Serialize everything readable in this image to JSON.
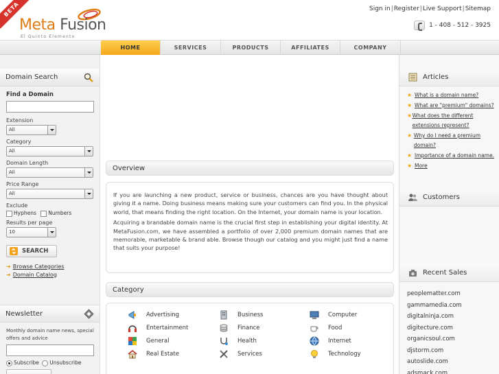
{
  "header": {
    "beta": "BETA",
    "logo_meta": "Meta",
    "logo_fusion": "Fusion",
    "tagline": "El Quinto Elemento",
    "links": [
      "Sign in",
      "Register",
      "Live Support",
      "Sitemap"
    ],
    "phone": "1 - 408 - 512 - 3925"
  },
  "nav": [
    "HOME",
    "SERVICES",
    "PRODUCTS",
    "AFFILIATES",
    "COMPANY"
  ],
  "domain_search": {
    "title": "Domain Search",
    "find_label": "Find a Domain",
    "find_value": "",
    "extension_label": "Extension",
    "extension_value": "All",
    "category_label": "Category",
    "category_value": "All",
    "length_label": "Domain Length",
    "length_value": "All",
    "price_label": "Price Range",
    "price_value": "All",
    "exclude_label": "Exclude",
    "hyphens": "Hyphens",
    "numbers": "Numbers",
    "results_label": "Results per page",
    "results_value": "10",
    "search_button": "SEARCH",
    "browse_link": "Browse Categories",
    "catalog_link": "Domain Catalog"
  },
  "newsletter": {
    "title": "Newsletter",
    "desc": "Monthly domain name news, special offers and advice",
    "email_value": "",
    "subscribe": "Subscribe",
    "unsubscribe": "Unsubscribe"
  },
  "overview": {
    "title": "Overview",
    "p1": "If you are launching a new product, service or business, chances are you have thought about giving it a name. Doing business means making sure your customers can find you. In the physical world, that means finding the right location. On the Internet, your domain name is your location.",
    "p2": "Acquiring a brandable domain name is the crucial first step in establishing your digital identity. At MetaFusion.com, we have assembled a portfolio of over 2,000 premium domain names that are memorable, marketable & brand able. Browse though our catalog and you might just find a name that suits your purpose!"
  },
  "category": {
    "title": "Category",
    "items": [
      "Advertising",
      "Business",
      "Computer",
      "Entertainment",
      "Finance",
      "Food",
      "General",
      "Health",
      "Internet",
      "Real Estate",
      "Services",
      "Technology"
    ]
  },
  "articles": {
    "title": "Articles",
    "items": [
      "What is a domain name?",
      "What are \"premium\" domains?",
      "What does the different extensions represent?",
      "Why do I need a premium domain?",
      "Importance of a domain name.",
      "More"
    ]
  },
  "customers": {
    "title": "Customers"
  },
  "recent_sales": {
    "title": "Recent Sales",
    "items": [
      "peoplematter.com",
      "gammamedia.com",
      "digitalninja.com",
      "digitecture.com",
      "organicsoul.com",
      "djstorm.com",
      "autoslide.com",
      "adsmack.com"
    ]
  },
  "colors": {
    "accent": "#f3a81a",
    "brand_orange": "#e07c16",
    "beta_red": "#d8322c"
  },
  "icons": {
    "search": "magnifier-icon",
    "articles": "notepad-icon",
    "customers": "people-icon",
    "sales": "camera-icon",
    "bullet": "star-icon",
    "newsletter": "diamond-icon"
  }
}
